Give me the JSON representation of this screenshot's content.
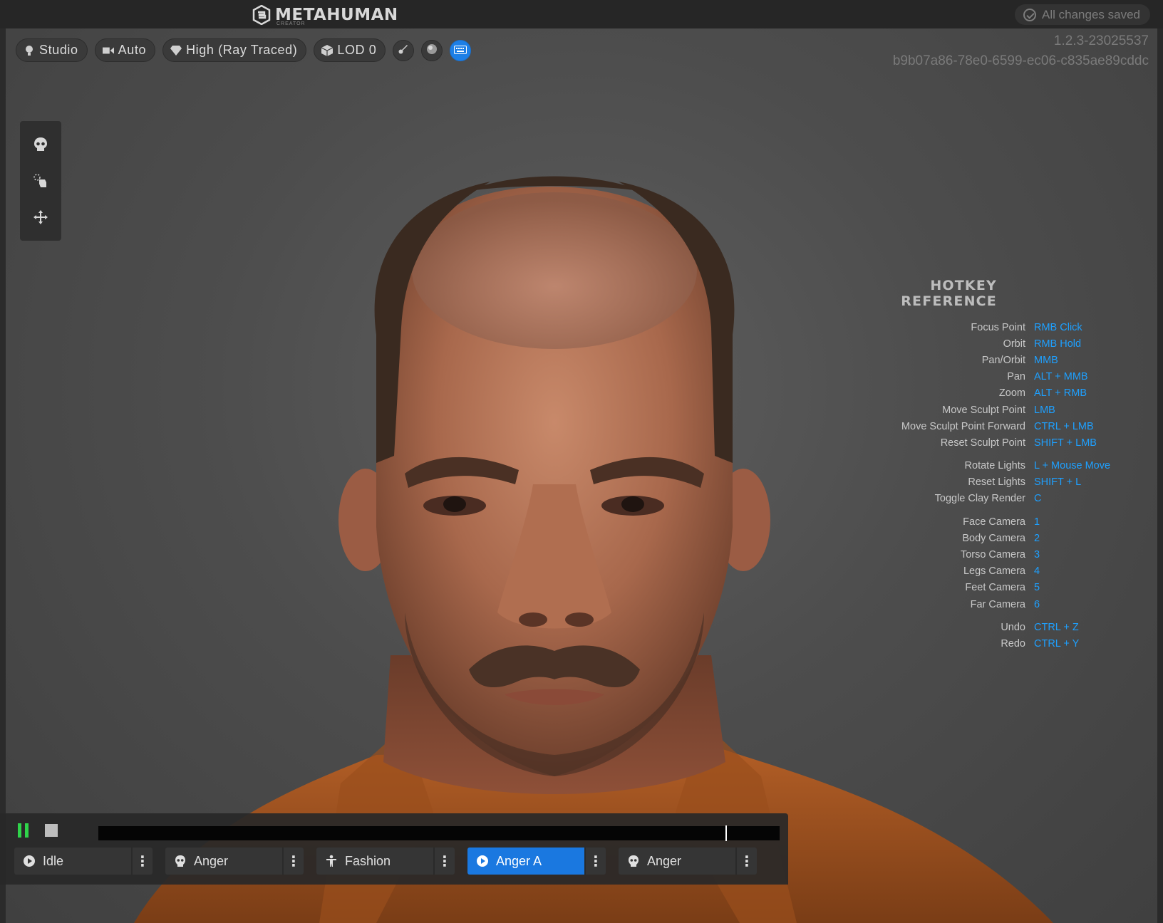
{
  "app": {
    "logo_text": "METAHUMAN",
    "logo_sub": "CREATOR",
    "save_status": "All changes saved",
    "version": "1.2.3-23025537",
    "session_id": "b9b07a86-78e0-6599-ec06-c835ae89cddc"
  },
  "toolbar": {
    "lighting": "Studio",
    "camera": "Auto",
    "quality": "High (Ray Traced)",
    "lod": "LOD 0"
  },
  "hotkeys": {
    "title": "HOTKEY REFERENCE",
    "groups": [
      [
        {
          "label": "Focus Point",
          "key": "RMB Click"
        },
        {
          "label": "Orbit",
          "key": "RMB Hold"
        },
        {
          "label": "Pan/Orbit",
          "key": "MMB"
        },
        {
          "label": "Pan",
          "key": "ALT + MMB"
        },
        {
          "label": "Zoom",
          "key": "ALT + RMB"
        },
        {
          "label": "Move Sculpt Point",
          "key": "LMB"
        },
        {
          "label": "Move Sculpt Point Forward",
          "key": "CTRL + LMB"
        },
        {
          "label": "Reset Sculpt Point",
          "key": "SHIFT + LMB"
        }
      ],
      [
        {
          "label": "Rotate Lights",
          "key": "L + Mouse Move"
        },
        {
          "label": "Reset Lights",
          "key": "SHIFT + L"
        },
        {
          "label": "Toggle Clay Render",
          "key": "C"
        }
      ],
      [
        {
          "label": "Face Camera",
          "key": "1"
        },
        {
          "label": "Body Camera",
          "key": "2"
        },
        {
          "label": "Torso Camera",
          "key": "3"
        },
        {
          "label": "Legs Camera",
          "key": "4"
        },
        {
          "label": "Feet Camera",
          "key": "5"
        },
        {
          "label": "Far Camera",
          "key": "6"
        }
      ],
      [
        {
          "label": "Undo",
          "key": "CTRL + Z"
        },
        {
          "label": "Redo",
          "key": "CTRL + Y"
        }
      ]
    ]
  },
  "timeline": {
    "progress": 0.92,
    "clips": [
      {
        "label": "Idle",
        "icon": "play-circle-icon",
        "active": false
      },
      {
        "label": "Anger",
        "icon": "face-icon",
        "active": false
      },
      {
        "label": "Fashion",
        "icon": "body-icon",
        "active": false
      },
      {
        "label": "Anger A",
        "icon": "play-circle-icon",
        "active": true
      },
      {
        "label": "Anger",
        "icon": "face-icon",
        "active": false
      }
    ]
  },
  "colors": {
    "accent": "#1d7fe6",
    "hotkey": "#1ea0ff",
    "play": "#2fd44a"
  }
}
